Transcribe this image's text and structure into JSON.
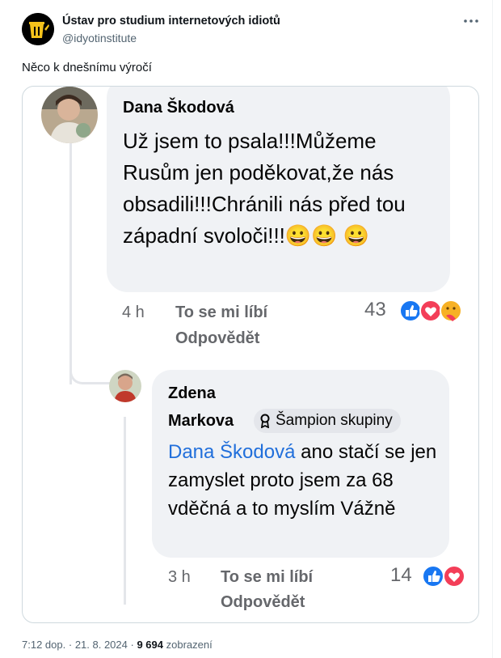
{
  "tweet": {
    "author_name": "Ústav pro studium internetových idiotů",
    "author_handle": "@idyotinstitute",
    "text": "Něco k dnešnímu výročí",
    "footer": {
      "time": "7:12 dop.",
      "separator": "·",
      "date": "21. 8. 2024",
      "separator2": "·",
      "views_count": "9 694",
      "views_label": "zobrazení"
    }
  },
  "screenshot": {
    "comment1": {
      "author": "Dana Škodová",
      "text": "Už jsem to psala!!!Můžeme Rusům jen poděkovat,že nás obsadili!!!Chránili nás před tou západní svoloči!!!😀😀 😀",
      "time": "4 h",
      "like_label": "To se mi líbí",
      "reply_label": "Odpovědět",
      "reaction_count": "43",
      "reactions": [
        "like",
        "love",
        "care"
      ]
    },
    "comment2": {
      "author_line1": "Zdena",
      "author_line2": "Markova",
      "badge_label": "Šampion skupiny",
      "mention": "Dana Škodová",
      "text": " ano stačí se jen zamyslet proto jsem za 68 vděčná a to myslím Vážně",
      "time": "3 h",
      "like_label": "To se mi líbí",
      "reply_label": "Odpovědět",
      "reaction_count": "14",
      "reactions": [
        "like",
        "love"
      ]
    }
  },
  "colors": {
    "handle_gray": "#536471",
    "fb_bubble": "#f0f2f5",
    "fb_meta_gray": "#65676b",
    "mention_blue": "#216fdb",
    "like_blue": "#1877f2",
    "love_red": "#f33e58"
  },
  "icons": {
    "avatar": "trash-bin-logo-icon",
    "more": "more-dots-icon",
    "badge": "champion-badge-icon"
  }
}
